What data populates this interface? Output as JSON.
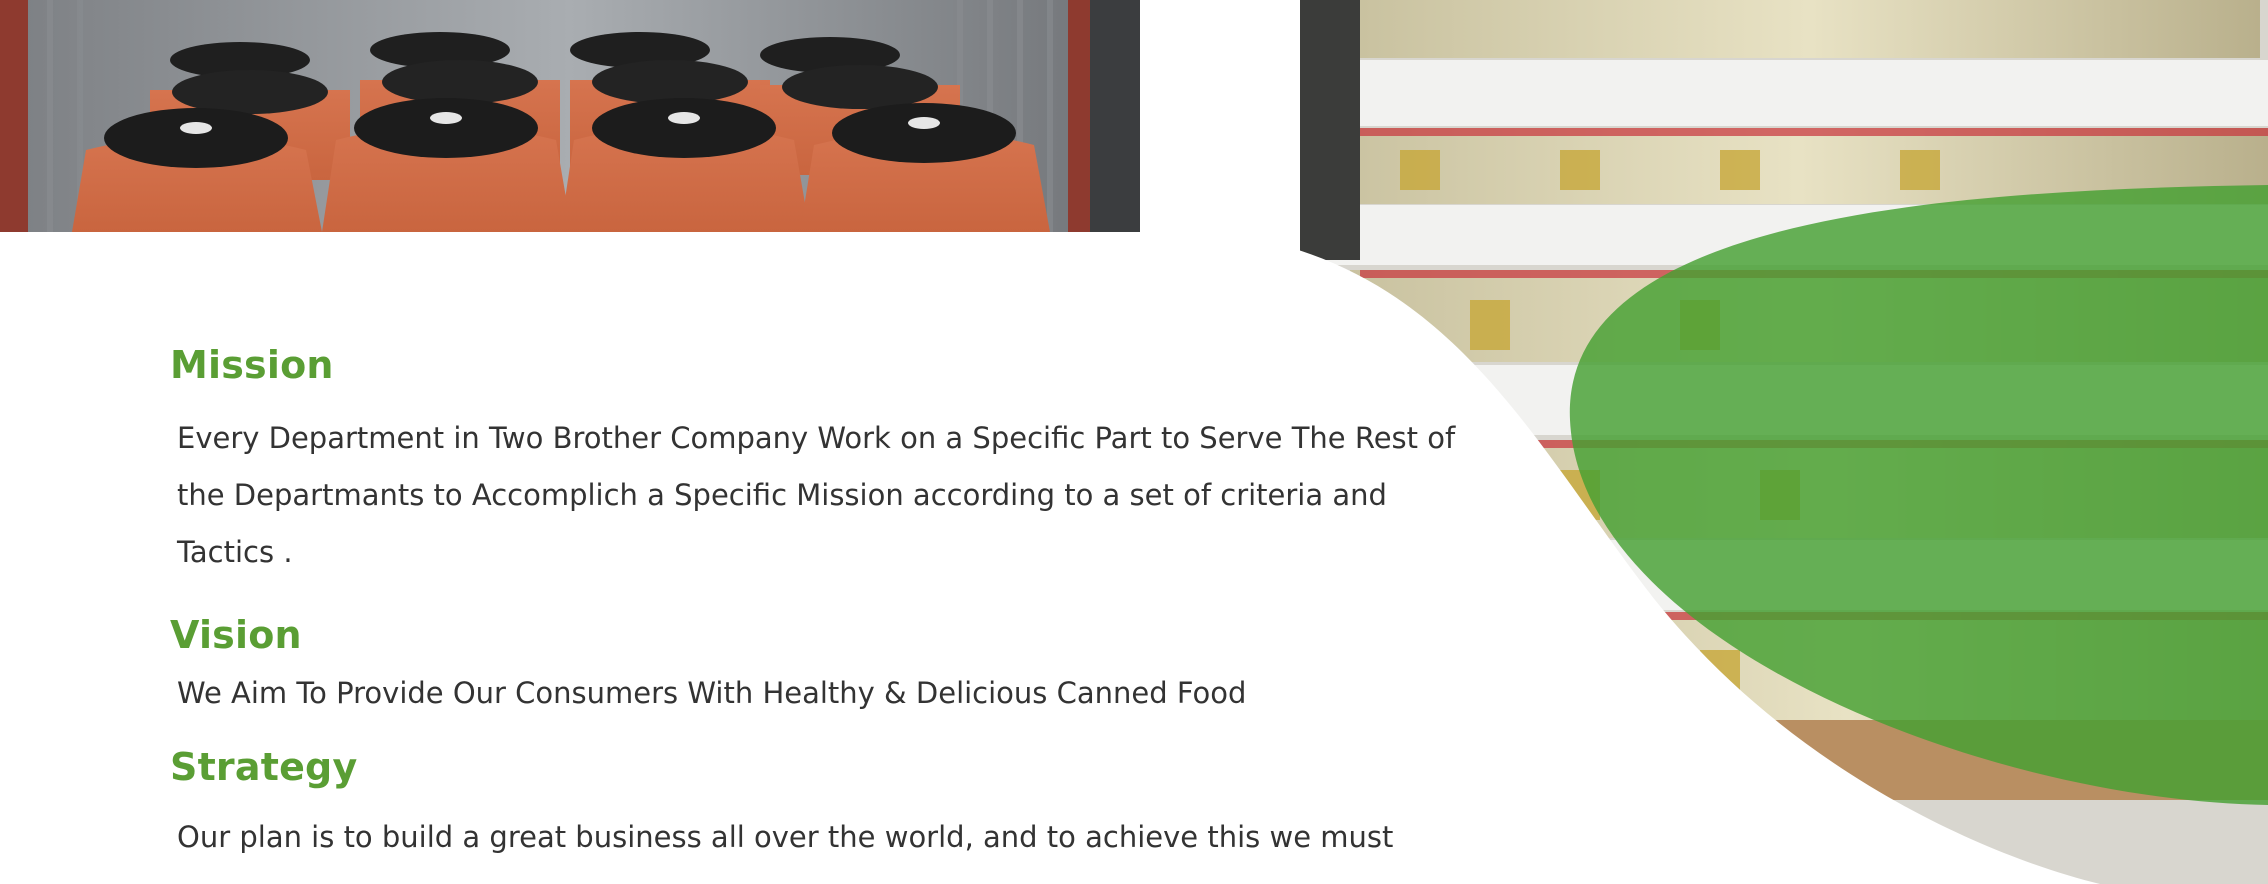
{
  "colors": {
    "accent_green": "#5a9e34",
    "text_dark": "#333333",
    "overlay_green": "#46a032"
  },
  "sections": {
    "mission": {
      "heading": "Mission",
      "body": "Every Department in Two Brother Company Work on a Specific Part to Serve The Rest of the Departmants to Accomplich a Specific Mission according to a set of criteria and Tactics ."
    },
    "vision": {
      "heading": "Vision",
      "body": "We Aim To Provide Our Consumers With Healthy & Delicious Canned Food"
    },
    "strategy": {
      "heading": "Strategy",
      "body": "Our plan is to build a great business all over the world, and to achieve this we must"
    }
  },
  "photos": {
    "left": "barrels-in-container-photo",
    "right": "stacked-jars-pallets-photo"
  }
}
